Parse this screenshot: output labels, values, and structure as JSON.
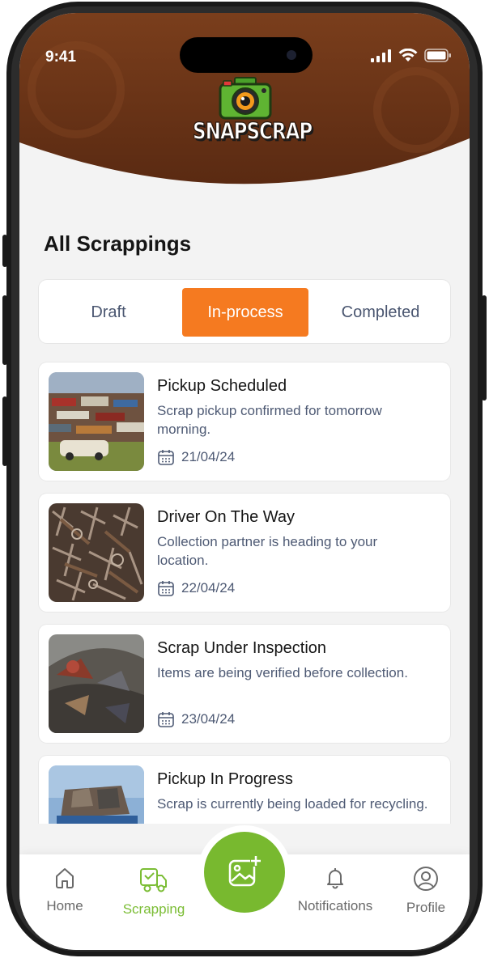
{
  "status_bar": {
    "time": "9:41"
  },
  "brand": {
    "logo_text": "SNAPSCRAP"
  },
  "page": {
    "title": "All Scrappings"
  },
  "tabs": [
    {
      "label": "Draft",
      "active": false
    },
    {
      "label": "In-process",
      "active": true
    },
    {
      "label": "Completed",
      "active": false
    }
  ],
  "cards": [
    {
      "title": "Pickup Scheduled",
      "desc": "Scrap pickup confirmed for tomorrow morning.",
      "date": "21/04/24"
    },
    {
      "title": "Driver On The Way",
      "desc": "Collection partner is heading to your location.",
      "date": "22/04/24"
    },
    {
      "title": "Scrap Under Inspection",
      "desc": "Items are being verified before collection.",
      "date": "23/04/24"
    },
    {
      "title": "Pickup In Progress",
      "desc": "Scrap is currently being loaded for recycling.",
      "date": ""
    }
  ],
  "nav": {
    "home": "Home",
    "scrapping": "Scrapping",
    "notifications": "Notifications",
    "profile": "Profile"
  },
  "colors": {
    "header_brown": "#6a3418",
    "accent_orange": "#f57a20",
    "accent_green": "#78b92f",
    "text_muted": "#4e5a74"
  }
}
